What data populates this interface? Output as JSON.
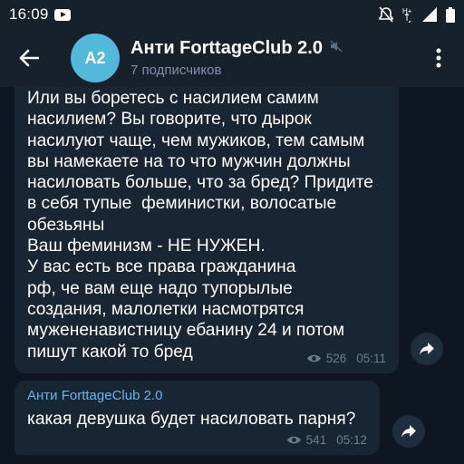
{
  "status_bar": {
    "time": "16:09",
    "icons": [
      "youtube-icon",
      "alarm-off-icon",
      "data-hplus-icon",
      "signal-icon",
      "battery-icon"
    ]
  },
  "header": {
    "avatar_initials": "A2",
    "title": "Анти ForttageClub 2.0",
    "subtitle": "7 подписчиков",
    "icons": [
      "back-arrow-icon",
      "muted-speaker-icon",
      "more-vert-icon"
    ]
  },
  "colors": {
    "background": "#0e1621",
    "header": "#17212b",
    "bubble": "#182533",
    "avatar": "#52b9da",
    "author_name": "#64b5ef",
    "meta_text": "#6d7f8f",
    "subtitle": "#7f91a4"
  },
  "messages": [
    {
      "text": "Или вы боретесь с насилием самим\nнасилием? Вы говорите, что дырок\nнасилуют чаще, чем мужиков, тем самым\nвы намекаете на то что мужчин должны\nнасиловать больше, что за бред? Придите\nв себя тупые  феминистки, волосатые\nобезьяны\nВаш феминизм - НЕ НУЖЕН.\nУ вас есть все права гражданина\nрф, че вам еще надо тупорылые\nсоздания, малолетки насмотрятся\nмужененавистницу ебанину 24 и потом\nпишут какой то бред",
      "views": "526",
      "time": "05:11"
    },
    {
      "author": "Анти ForttageClub 2.0",
      "text": "какая девушка будет насиловать парня?",
      "views": "541",
      "time": "05:12"
    }
  ]
}
